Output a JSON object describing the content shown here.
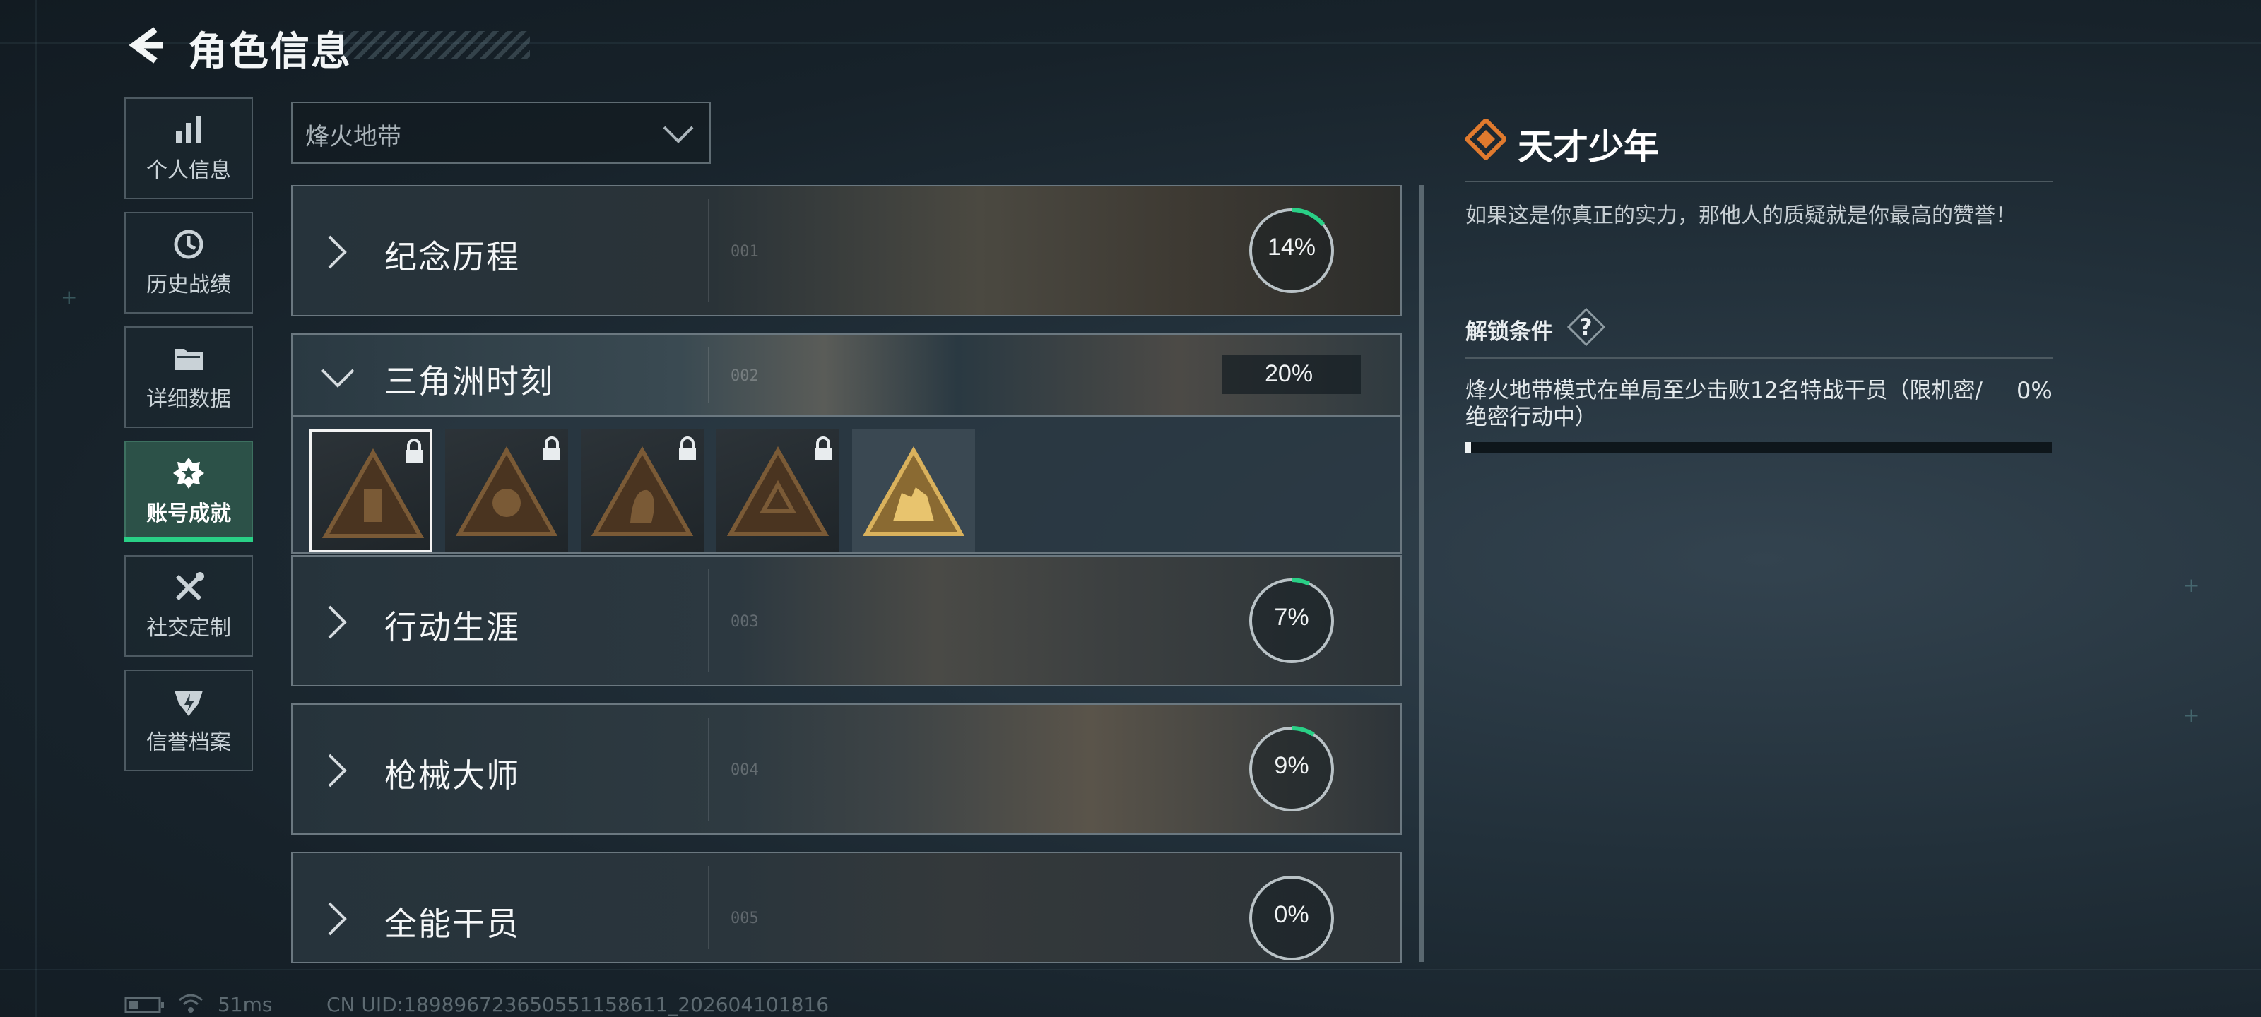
{
  "header": {
    "title": "角色信息"
  },
  "sidebar": {
    "items": [
      {
        "label": "个人信息",
        "icon": "bar-chart-icon",
        "active": false
      },
      {
        "label": "历史战绩",
        "icon": "history-icon",
        "active": false
      },
      {
        "label": "详细数据",
        "icon": "folder-icon",
        "active": false
      },
      {
        "label": "账号成就",
        "icon": "achievement-icon",
        "active": true
      },
      {
        "label": "社交定制",
        "icon": "tools-icon",
        "active": false
      },
      {
        "label": "信誉档案",
        "icon": "shield-icon",
        "active": false
      }
    ]
  },
  "mode_select": {
    "value": "烽火地带"
  },
  "categories": [
    {
      "name": "纪念历程",
      "num": "001",
      "progress_label": "14%",
      "progress": 0.14,
      "expanded": false
    },
    {
      "name": "三角洲时刻",
      "num": "002",
      "progress_label": "20%",
      "progress": 0.2,
      "expanded": true
    },
    {
      "name": "行动生涯",
      "num": "003",
      "progress_label": "7%",
      "progress": 0.07,
      "expanded": false
    },
    {
      "name": "枪械大师",
      "num": "004",
      "progress_label": "9%",
      "progress": 0.09,
      "expanded": false
    },
    {
      "name": "全能干员",
      "num": "005",
      "progress_label": "0%",
      "progress": 0.0,
      "expanded": false
    }
  ],
  "badges": [
    {
      "locked": true,
      "selected": true
    },
    {
      "locked": true,
      "selected": false
    },
    {
      "locked": true,
      "selected": false
    },
    {
      "locked": true,
      "selected": false
    },
    {
      "locked": false,
      "selected": false
    }
  ],
  "detail": {
    "title": "天才少年",
    "description": "如果这是你真正的实力，那他人的质疑就是你最高的赞誉！",
    "unlock_title": "解锁条件",
    "help_label": "?",
    "condition": "烽火地带模式在单局至少击败12名特战干员（限机密/绝密行动中）",
    "condition_progress_label": "0%",
    "condition_progress": 0.01
  },
  "status_bar": {
    "ping": "51ms",
    "uid": "CN UID:189896723650551158611_202604101816"
  },
  "colors": {
    "accent_green": "#29d086",
    "gold": "#c9a35a",
    "orange": "#e07a2e"
  }
}
